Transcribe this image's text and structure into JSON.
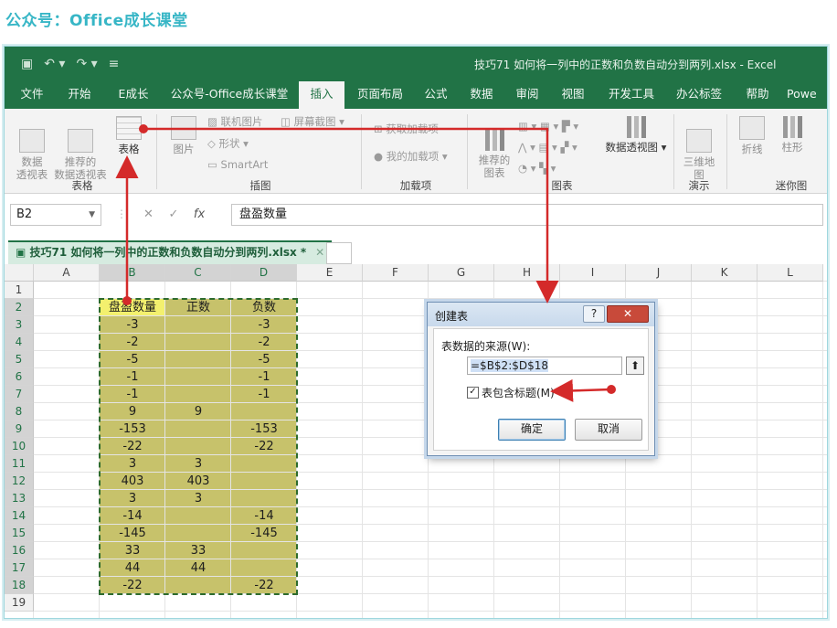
{
  "brand": "公众号：Office成长课堂",
  "window": {
    "title": "技巧71  如何将一列中的正数和负数自动分到两列.xlsx  -  Excel",
    "qat": [
      "save-icon",
      "undo-icon",
      "redo-icon",
      "customize-icon"
    ]
  },
  "ribbon": {
    "tabs": [
      "文件",
      "开始",
      "E成长",
      "公众号-Office成长课堂",
      "插入",
      "页面布局",
      "公式",
      "数据",
      "审阅",
      "视图",
      "开发工具",
      "办公标签",
      "帮助",
      "Powe"
    ],
    "active_tab": "插入",
    "groups": {
      "tables": {
        "name": "表格",
        "pivot": "数据\n透视表",
        "recommended_pivot": "推荐的\n数据透视表",
        "table": "表格"
      },
      "illustrations": {
        "name": "插图",
        "picture": "图片",
        "online_picture": "联机图片",
        "shapes": "形状",
        "smartart": "SmartArt",
        "screenshot": "屏幕截图"
      },
      "addins": {
        "name": "加载项",
        "get_addins": "获取加载项",
        "my_addins": "我的加载项"
      },
      "charts": {
        "name": "图表",
        "recommended_charts": "推荐的\n图表",
        "pivot_chart": "数据透视图"
      },
      "tours": {
        "name": "演示",
        "map3d": "三维地\n图"
      },
      "sparklines": {
        "name": "迷你图",
        "line": "折线",
        "column": "柱形"
      }
    }
  },
  "formula_bar": {
    "name_box": "B2",
    "cancel_icon": "✕",
    "enter_icon": "✓",
    "fx": "fx",
    "content": "盘盈数量"
  },
  "workbook_tab": {
    "name": "技巧71  如何将一列中的正数和负数自动分到两列.xlsx *",
    "close": "✕"
  },
  "sheet": {
    "columns": [
      "A",
      "B",
      "C",
      "D",
      "E",
      "F",
      "G",
      "H",
      "I",
      "J",
      "K",
      "L"
    ],
    "rows": [
      "1",
      "2",
      "3",
      "4",
      "5",
      "6",
      "7",
      "8",
      "9",
      "10",
      "11",
      "12",
      "13",
      "14",
      "15",
      "16",
      "17",
      "18",
      "19"
    ],
    "headers": [
      "盘盈数量",
      "正数",
      "负数"
    ],
    "data": [
      [
        "-3",
        "",
        "-3"
      ],
      [
        "-2",
        "",
        "-2"
      ],
      [
        "-5",
        "",
        "-5"
      ],
      [
        "-1",
        "",
        "-1"
      ],
      [
        "-1",
        "",
        "-1"
      ],
      [
        "9",
        "9",
        ""
      ],
      [
        "-153",
        "",
        "-153"
      ],
      [
        "-22",
        "",
        "-22"
      ],
      [
        "3",
        "3",
        ""
      ],
      [
        "403",
        "403",
        ""
      ],
      [
        "3",
        "3",
        ""
      ],
      [
        "-14",
        "",
        "-14"
      ],
      [
        "-145",
        "",
        "-145"
      ],
      [
        "33",
        "33",
        ""
      ],
      [
        "44",
        "44",
        ""
      ],
      [
        "-22",
        "",
        "-22"
      ]
    ]
  },
  "dialog": {
    "title": "创建表",
    "help": "?",
    "close": "✕",
    "source_label": "表数据的来源(W):",
    "range_value": "=$B$2:$D$18",
    "collapse_icon": "⬆",
    "has_headers_label": "表包含标题(M)",
    "has_headers_checked": "✓",
    "ok": "确定",
    "cancel": "取消"
  },
  "colors": {
    "excel_green": "#217346",
    "data_fill": "#c7c26b",
    "header_fill": "#f3f06e",
    "annotation_red": "#d42a2a",
    "brand": "#37b6c6"
  }
}
